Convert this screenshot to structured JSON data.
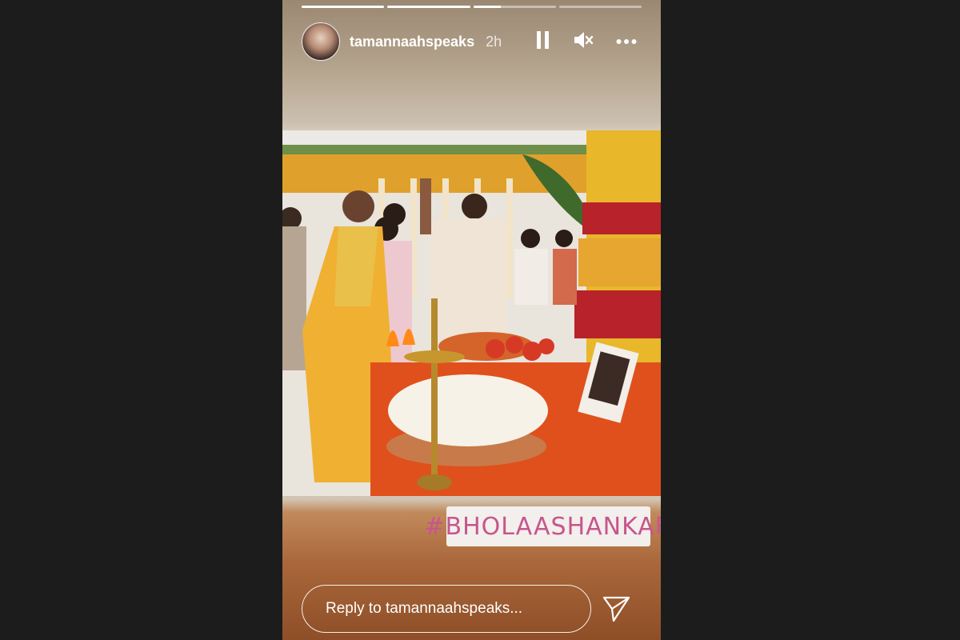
{
  "story": {
    "username": "tamannaahspeaks",
    "time_ago": "2h",
    "progress": [
      1.0,
      1.0,
      0.33,
      0.0
    ],
    "hashtag": "#BHOLAASHANKAR",
    "reply_placeholder": "Reply to tamannaahspeaks..."
  },
  "icons": {
    "pause": "pause-icon",
    "mute": "mute-icon",
    "more": "more-icon",
    "send": "send-icon"
  },
  "colors": {
    "hashtag_text": "#c7558d",
    "page_background": "#1c1c1c"
  }
}
